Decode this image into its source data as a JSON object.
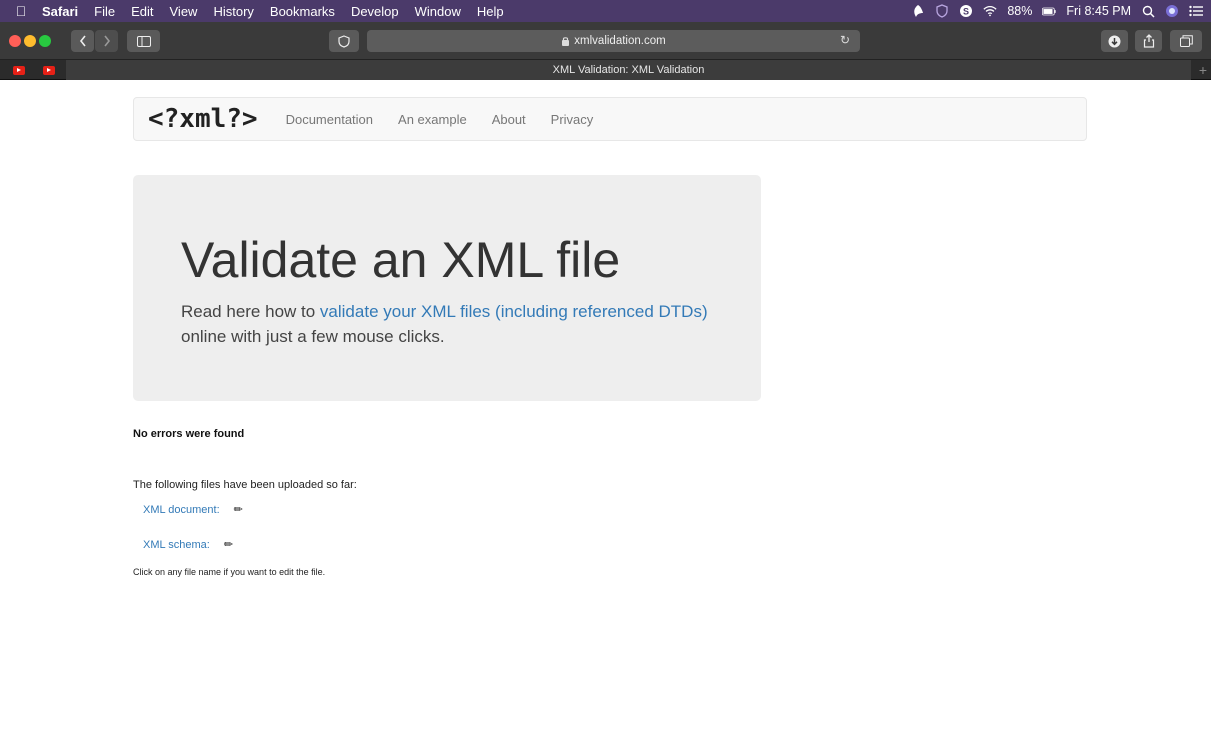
{
  "menubar": {
    "apple_icon": "apple-icon",
    "items": [
      "Safari",
      "File",
      "Edit",
      "View",
      "History",
      "Bookmarks",
      "Develop",
      "Window",
      "Help"
    ],
    "battery": "88%",
    "clock": "Fri 8:45 PM"
  },
  "toolbar": {
    "url": "xmlvalidation.com"
  },
  "tabs": {
    "active_title": "XML Validation: XML Validation"
  },
  "navbar": {
    "brand": "<?xml?>",
    "links": [
      "Documentation",
      "An example",
      "About",
      "Privacy"
    ]
  },
  "jumbotron": {
    "heading": "Validate an XML file",
    "text_before": "Read here how to ",
    "link_text": "validate your XML files (including referenced DTDs)",
    "text_after": " online with just a few mouse clicks."
  },
  "results": {
    "status": "No errors were found",
    "uploaded_label": "The following files have been uploaded so far:",
    "files": [
      {
        "name": "XML document:"
      },
      {
        "name": "XML schema:"
      }
    ],
    "hint": "Click on any file name if you want to edit the file."
  },
  "colors": {
    "menubar_bg": "#4b3a6a",
    "link": "#337ab7",
    "jumbo_bg": "#eeeeee"
  }
}
